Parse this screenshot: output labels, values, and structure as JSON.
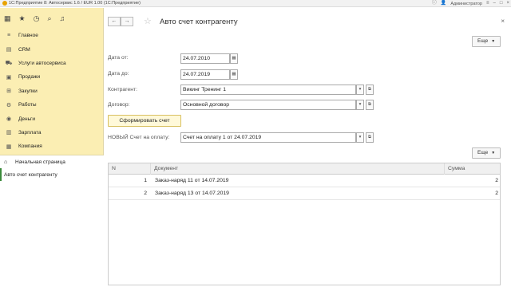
{
  "window": {
    "title": "1С:Предприятие 8: Автосервис 1.6 / EUR 1.00  (1С:Предприятие)",
    "user": "Администратор"
  },
  "sidebar": {
    "items": [
      {
        "label": "Главное",
        "icon": "menu-icon"
      },
      {
        "label": "CRM",
        "icon": "crm-icon"
      },
      {
        "label": "Услуги автосервиса",
        "icon": "car-icon"
      },
      {
        "label": "Продажи",
        "icon": "sales-icon"
      },
      {
        "label": "Закупки",
        "icon": "cart-icon"
      },
      {
        "label": "Работы",
        "icon": "wrench-icon"
      },
      {
        "label": "Деньги",
        "icon": "money-icon"
      },
      {
        "label": "Зарплата",
        "icon": "salary-icon"
      },
      {
        "label": "Компания",
        "icon": "company-icon"
      }
    ],
    "open_windows": [
      {
        "label": "Начальная страница",
        "icon": "home-icon"
      },
      {
        "label": "Авто счет контрагенту",
        "icon": ""
      }
    ]
  },
  "main": {
    "title": "Авто счет контрагенту",
    "more_label": "Еще",
    "fields": {
      "date_from_label": "Дата от:",
      "date_from_value": "24.07.2010",
      "date_to_label": "Дата до:",
      "date_to_value": "24.07.2019",
      "contractor_label": "Контрагент:",
      "contractor_value": "Викинг Тренинг 1",
      "contract_label": "Договор:",
      "contract_value": "Основной договор",
      "new_invoice_label": "НОВЫЙ Счет на оплату:",
      "new_invoice_value": "Счет на оплату 1 от 24.07.2019"
    },
    "form_button": "Сформировать счет",
    "table": {
      "more_label": "Еще",
      "headers": [
        "N",
        "Документ",
        "Сумма"
      ],
      "rows": [
        [
          "1",
          "Заказ-наряд 11 от 14.07.2019",
          "2"
        ],
        [
          "2",
          "Заказ-наряд 13 от 14.07.2019",
          "2"
        ]
      ]
    }
  }
}
